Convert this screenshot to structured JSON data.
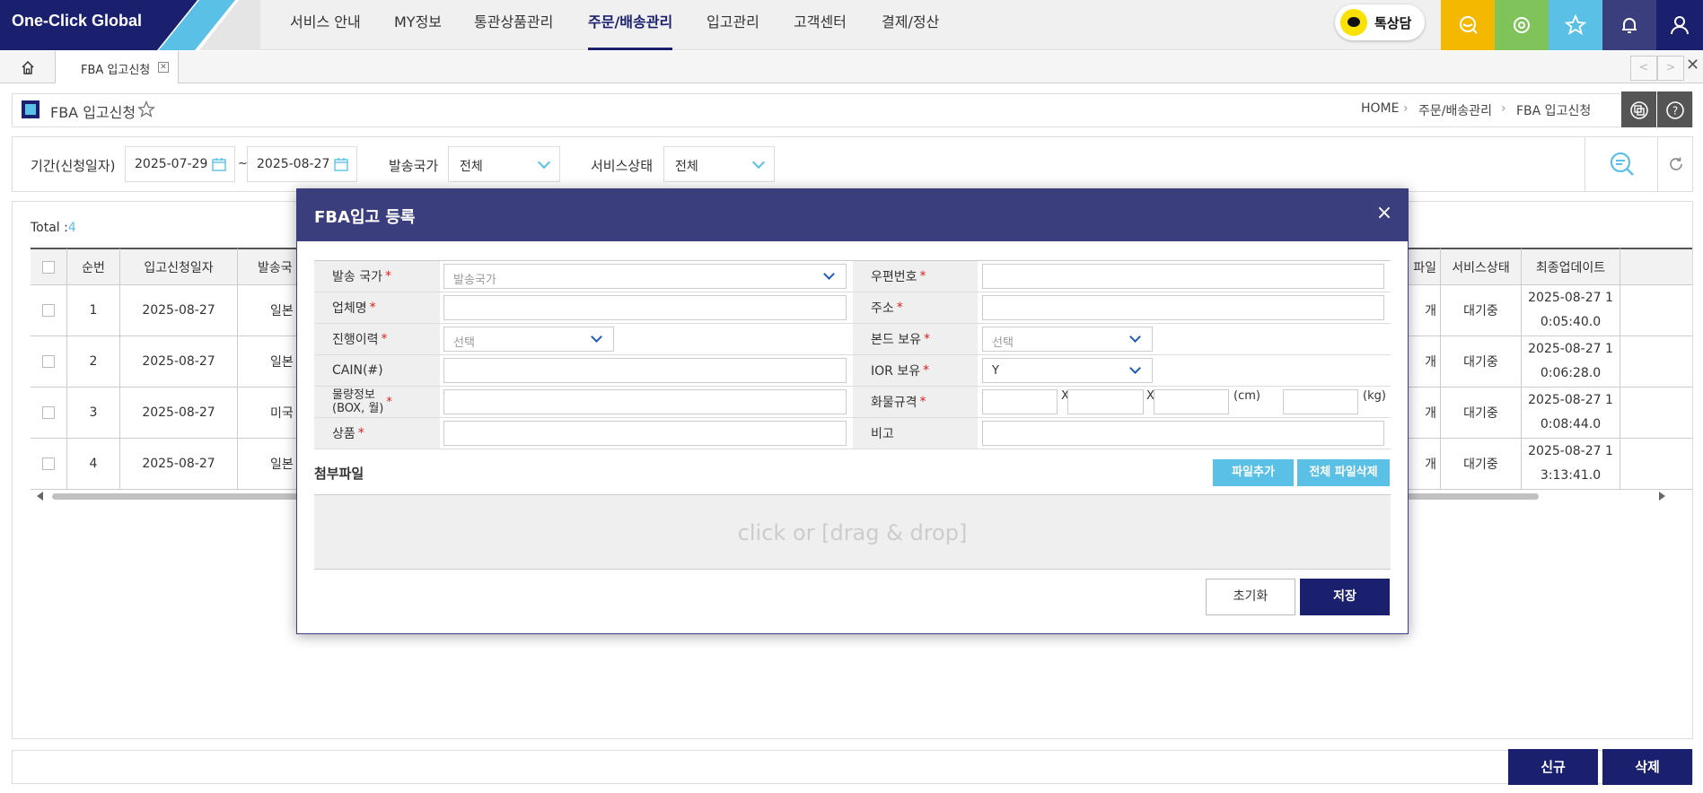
{
  "app": {
    "logo": "One-Click Global"
  },
  "nav": {
    "items": [
      "서비스 안내",
      "MY정보",
      "통관상품관리",
      "주문/배송관리",
      "입고관리",
      "고객센터",
      "결제/정산"
    ],
    "active": "주문/배송관리",
    "kakao_label": "톡상담"
  },
  "top_icons": [
    {
      "name": "search-chat-icon",
      "color": "#f5b800"
    },
    {
      "name": "settings-icon",
      "color": "#7fc35a"
    },
    {
      "name": "star-icon",
      "color": "#5ac0e6"
    },
    {
      "name": "bell-icon",
      "color": "#3b3e7c"
    },
    {
      "name": "user-icon",
      "color": "#1a1f6e"
    }
  ],
  "tabs": {
    "open_tab": "FBA 입고신청"
  },
  "page": {
    "title": "FBA 입고신청",
    "breadcrumb": [
      "HOME",
      "주문/배송관리",
      "FBA 입고신청"
    ]
  },
  "filter": {
    "period_label": "기간(신청일자)",
    "date_from": "2025-07-29",
    "date_sep": "~",
    "date_to": "2025-08-27",
    "country_label": "발송국가",
    "country_value": "전체",
    "status_label": "서비스상태",
    "status_value": "전체"
  },
  "grid": {
    "total_label": "Total :",
    "total": "4",
    "headers": {
      "no": "순번",
      "date": "입고신청일자",
      "country": "발송국",
      "file": "파일",
      "status": "서비스상태",
      "updated": "최종업데이트"
    },
    "rows": [
      {
        "no": "1",
        "date": "2025-08-27",
        "country": "일본",
        "file": "개",
        "status": "대기중",
        "updated_1": "2025-08-27 1",
        "updated_2": "0:05:40.0"
      },
      {
        "no": "2",
        "date": "2025-08-27",
        "country": "일본",
        "file": "개",
        "status": "대기중",
        "updated_1": "2025-08-27 1",
        "updated_2": "0:06:28.0"
      },
      {
        "no": "3",
        "date": "2025-08-27",
        "country": "미국",
        "file": "개",
        "status": "대기중",
        "updated_1": "2025-08-27 1",
        "updated_2": "0:08:44.0"
      },
      {
        "no": "4",
        "date": "2025-08-27",
        "country": "일본",
        "file": "개",
        "status": "대기중",
        "updated_1": "2025-08-27 1",
        "updated_2": "3:13:41.0"
      }
    ]
  },
  "bottom": {
    "new_label": "신규",
    "delete_label": "삭제"
  },
  "dialog": {
    "title": "FBA입고 등록",
    "close": "×",
    "fields": {
      "country": {
        "label": "발송 국가",
        "req": "*",
        "placeholder": "발송국가"
      },
      "postcode": {
        "label": "우편번호",
        "req": "*"
      },
      "company": {
        "label": "업체명",
        "req": "*"
      },
      "address": {
        "label": "주소",
        "req": "*"
      },
      "history": {
        "label": "진행이력",
        "req": "*",
        "placeholder": "선택"
      },
      "bond": {
        "label": "본드 보유",
        "req": "*",
        "placeholder": "선택"
      },
      "cain": {
        "label": "CAIN(#)"
      },
      "ior": {
        "label": "IOR 보유",
        "req": "*",
        "value": "Y"
      },
      "weight": {
        "label": "물량정보\n(BOX, 월)",
        "req": "*"
      },
      "cargo": {
        "label": "화물규격",
        "req": "*",
        "x1": "X",
        "x2": "X",
        "unit_cm": "(cm)",
        "unit_kg": "(kg)"
      },
      "product": {
        "label": "상품",
        "req": "*"
      },
      "memo": {
        "label": "비고"
      }
    },
    "attach_label": "첨부파일",
    "add_file": "파일추가",
    "delete_all_files": "전체 파일삭제",
    "dropzone": "click or [drag & drop]",
    "reset": "초기화",
    "save": "저장"
  }
}
